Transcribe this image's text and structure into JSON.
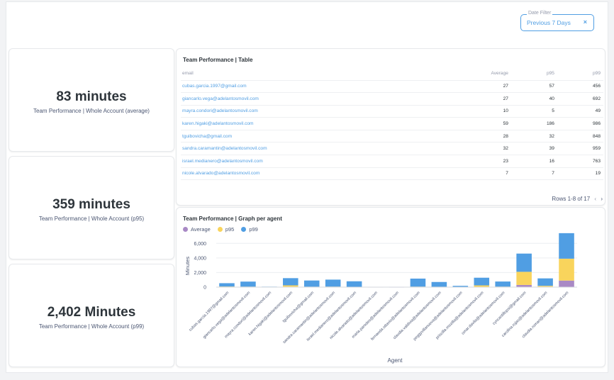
{
  "filter": {
    "label": "Date Filter",
    "value": "Previous 7 Days",
    "clear_icon": "×"
  },
  "kpis": [
    {
      "value": "83 minutes",
      "label": "Team Performance | Whole Account (average)"
    },
    {
      "value": "359 minutes",
      "label": "Team Performance | Whole Account (p95)"
    },
    {
      "value": "2,402 Minutes",
      "label": "Team Performance | Whole Account (p99)"
    }
  ],
  "table": {
    "title": "Team Performance | Table",
    "headers": {
      "email": "email",
      "average": "Average",
      "p95": "p95",
      "p99": "p99"
    },
    "rows": [
      {
        "email": "cubas.garcia.1997@gmail.com",
        "average": "27",
        "p95": "57",
        "p99": "456"
      },
      {
        "email": "giancarlo.vega@adelantosmovil.com",
        "average": "27",
        "p95": "40",
        "p99": "692"
      },
      {
        "email": "mayra.condori@adelantosmovil.com",
        "average": "10",
        "p95": "5",
        "p99": "49"
      },
      {
        "email": "karen.higaki@adelantosmovil.com",
        "average": "59",
        "p95": "186",
        "p99": "986"
      },
      {
        "email": "tguibovicha@gmail.com",
        "average": "28",
        "p95": "32",
        "p99": "848"
      },
      {
        "email": "sandra.caramantin@adelantosmovil.com",
        "average": "32",
        "p95": "39",
        "p99": "959"
      },
      {
        "email": "israel.medianero@adelantosmovil.com",
        "average": "23",
        "p95": "16",
        "p99": "763"
      },
      {
        "email": "nicole.alvarado@adelantosmovil.com",
        "average": "7",
        "p95": "7",
        "p99": "19"
      }
    ],
    "pagination": "Rows 1-8 of 17",
    "prev_icon": "‹",
    "next_icon": "›"
  },
  "graph": {
    "title": "Team Performance | Graph per agent"
  },
  "chart_data": {
    "type": "bar",
    "stacked": true,
    "xlabel": "Agent",
    "ylabel": "Minutes",
    "ylim": [
      0,
      7000
    ],
    "yticks": [
      "0",
      "2,000",
      "4,000",
      "6,000"
    ],
    "ytick_values": [
      0,
      2000,
      4000,
      6000
    ],
    "legend_position": "top-left",
    "categories": [
      "cubas.garcia.1997@gmail.com",
      "giancarlo.vega@adelantosmovil.com",
      "mayra.condori@adelantosmovil.com",
      "karen.higaki@adelantosmovil.com",
      "tguibovicha@gmail.com",
      "sandra.caramantin@adelantosmovil.com",
      "israel.medianero@adelantosmovil.com",
      "nicole.alvarado@adelantosmovil.com",
      "maria.paredes@adelantosmovil.com",
      "fernanda.ottavio@adelantosmovil.com",
      "claudia.valdivia@adelantosmovil.com",
      "peggyvillanueva@adelantosmovil.com",
      "priscilla.mozilla@adelantosmovil.com",
      "omar.davila@adelantosmovil.com",
      "cyncastillopsi@gmail.com",
      "carolina.rojas@adelantosmovil.com",
      "claudia.roman@adelantosmovil.com"
    ],
    "series": [
      {
        "name": "Average",
        "color": "#a989c5",
        "values": [
          27,
          27,
          10,
          59,
          28,
          32,
          23,
          7,
          5,
          25,
          20,
          10,
          40,
          25,
          300,
          60,
          900
        ]
      },
      {
        "name": "p95",
        "color": "#f9d45c",
        "values": [
          57,
          40,
          5,
          186,
          32,
          39,
          16,
          7,
          5,
          45,
          35,
          15,
          200,
          45,
          1800,
          120,
          3000
        ]
      },
      {
        "name": "p99",
        "color": "#509ee3",
        "values": [
          456,
          692,
          49,
          986,
          848,
          959,
          763,
          19,
          40,
          1100,
          650,
          150,
          1050,
          700,
          2500,
          1020,
          3500
        ]
      }
    ]
  }
}
